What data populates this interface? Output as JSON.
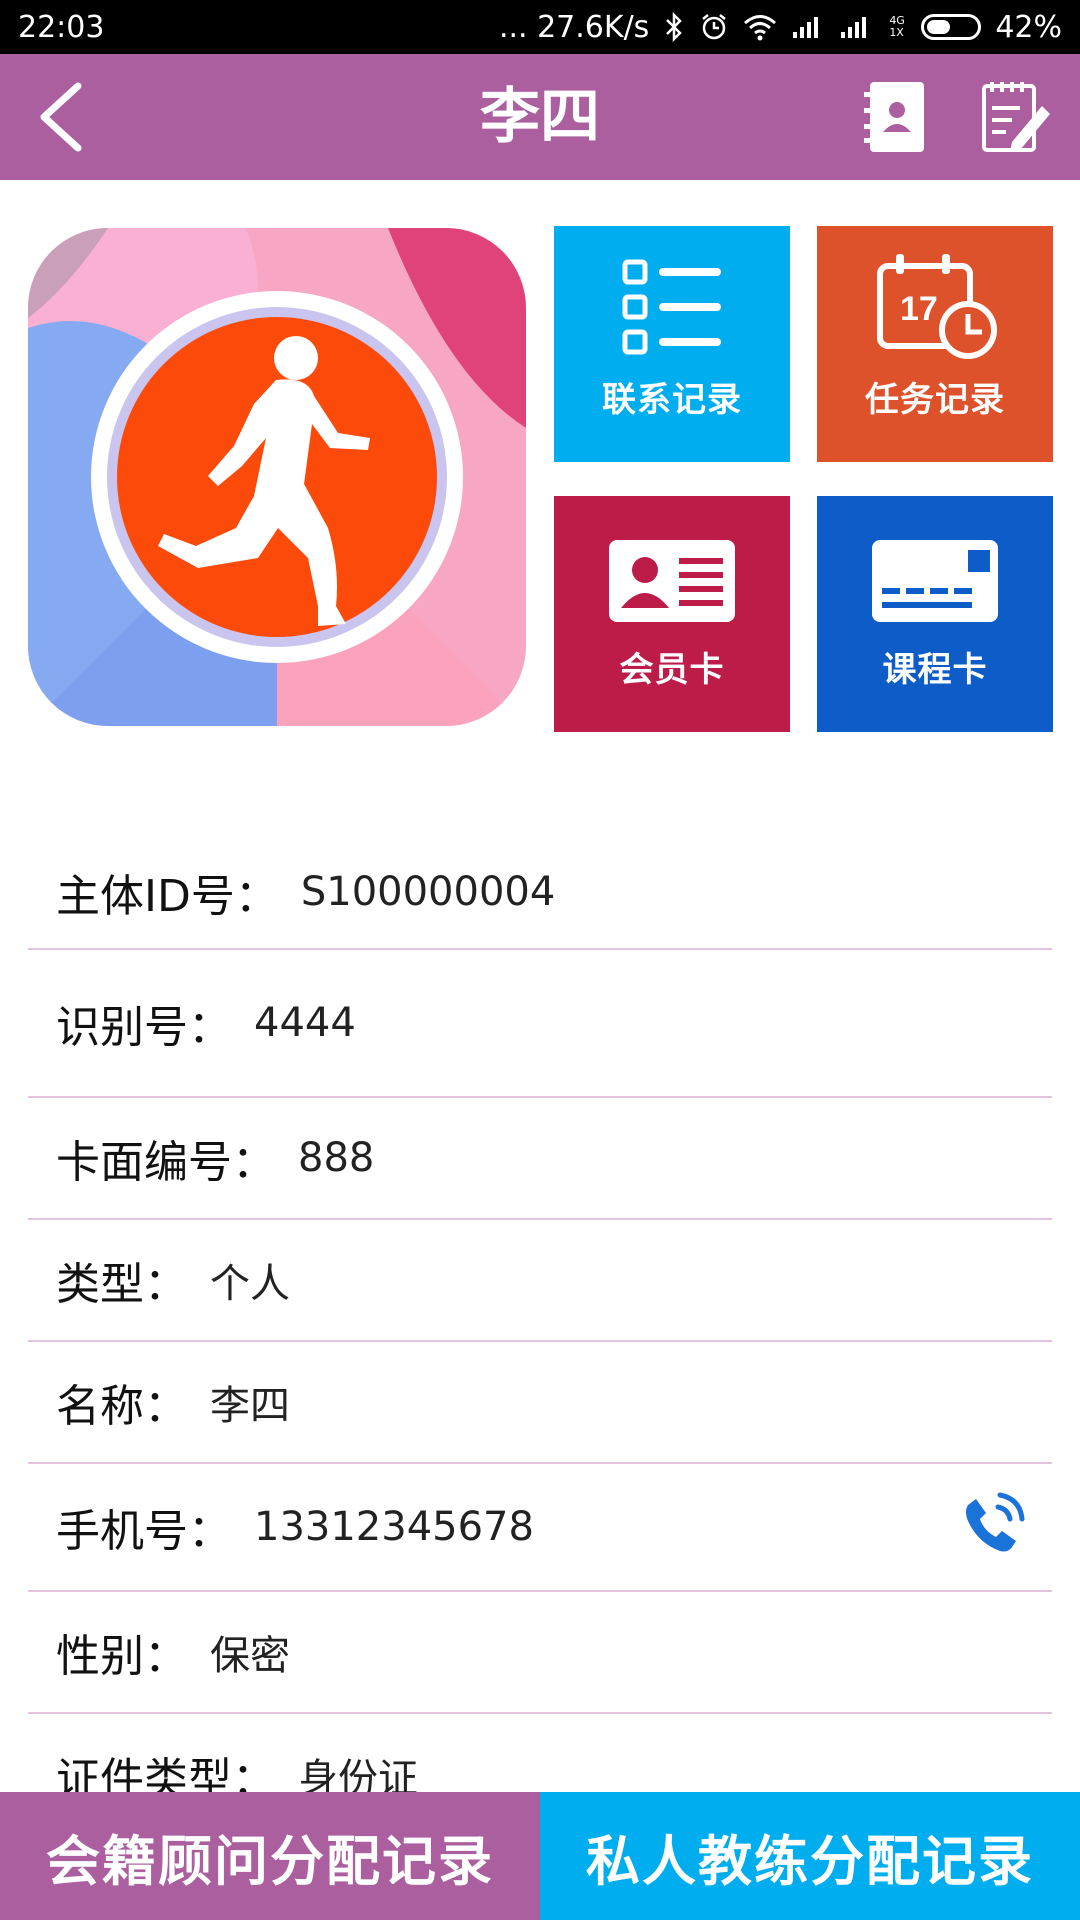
{
  "status_bar": {
    "time": "22:03",
    "network_speed": "... 27.6K/s",
    "battery": "42%",
    "net_label": "4G 1X"
  },
  "header": {
    "title": "李四",
    "back_icon": "chevron-left-icon",
    "contacts_icon": "address-book-icon",
    "edit_icon": "edit-note-icon"
  },
  "tiles": [
    {
      "label": "联系记录",
      "icon": "list-icon",
      "color": "#00adee"
    },
    {
      "label": "任务记录",
      "icon": "calendar-clock-icon",
      "color": "#dd522b",
      "calendar_day": "17"
    },
    {
      "label": "会员卡",
      "icon": "id-card-icon",
      "color": "#bd1b48"
    },
    {
      "label": "课程卡",
      "icon": "course-card-icon",
      "color": "#0d5cc7"
    }
  ],
  "info": [
    {
      "label": "主体ID号：",
      "value": "S100000004"
    },
    {
      "label": "识别号：",
      "value": "4444"
    },
    {
      "label": "卡面编号：",
      "value": "888"
    },
    {
      "label": "类型：",
      "value": "个人"
    },
    {
      "label": "名称：",
      "value": "李四"
    },
    {
      "label": "手机号：",
      "value": "13312345678"
    },
    {
      "label": "性别：",
      "value": "保密"
    },
    {
      "label": "证件类型：",
      "value": "身份证"
    }
  ],
  "bottom": {
    "left_label": "会籍顾问分配记录",
    "right_label": "私人教练分配记录"
  },
  "colors": {
    "header_bg": "#ab5f9f",
    "bottom_left_bg": "#ab5f9f",
    "bottom_right_bg": "#00adee",
    "divider": "#e2c4de",
    "phone_icon": "#1a73d9"
  }
}
